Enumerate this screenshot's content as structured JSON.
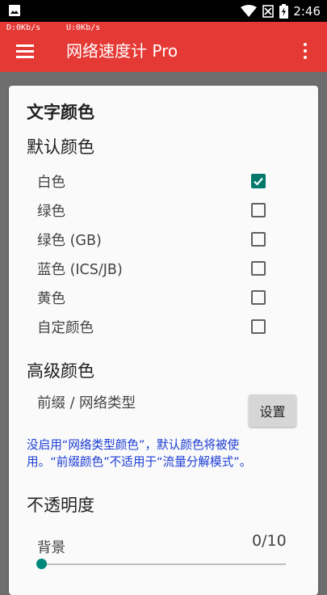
{
  "statusbar": {
    "time": "2:46",
    "icons": [
      "image-icon",
      "wifi-icon",
      "no-sim-icon",
      "battery-charging-icon"
    ]
  },
  "speed": {
    "download": "D:0Kb/s",
    "upload": "U:0Kb/s"
  },
  "appbar": {
    "title": "网络速度计 Pro",
    "menu_icon": "hamburger-menu-icon",
    "overflow_icon": "more-vert-icon"
  },
  "colors": {
    "accent": "#e53935",
    "check": "#00796b",
    "note": "#1a3bd6",
    "slider": "#00897b"
  },
  "settings": {
    "text_color_title": "文字颜色",
    "default_color_title": "默认颜色",
    "color_options": [
      {
        "label": "白色",
        "checked": true
      },
      {
        "label": "绿色",
        "checked": false
      },
      {
        "label": "绿色 (GB)",
        "checked": false
      },
      {
        "label": "蓝色 (ICS/JB)",
        "checked": false
      },
      {
        "label": "黄色",
        "checked": false
      },
      {
        "label": "自定颜色",
        "checked": false
      }
    ],
    "advanced_color_title": "高级颜色",
    "prefix_label": "前缀 / 网络类型",
    "set_button": "设置",
    "note_line1": "没启用“网络类型颜色”，默认颜色将被使",
    "note_line2": "用。“前缀颜色”不适用于“流量分解模式”。",
    "opacity_title": "不透明度",
    "background_label": "背景",
    "background_value": "0/10",
    "background_level": 0
  }
}
